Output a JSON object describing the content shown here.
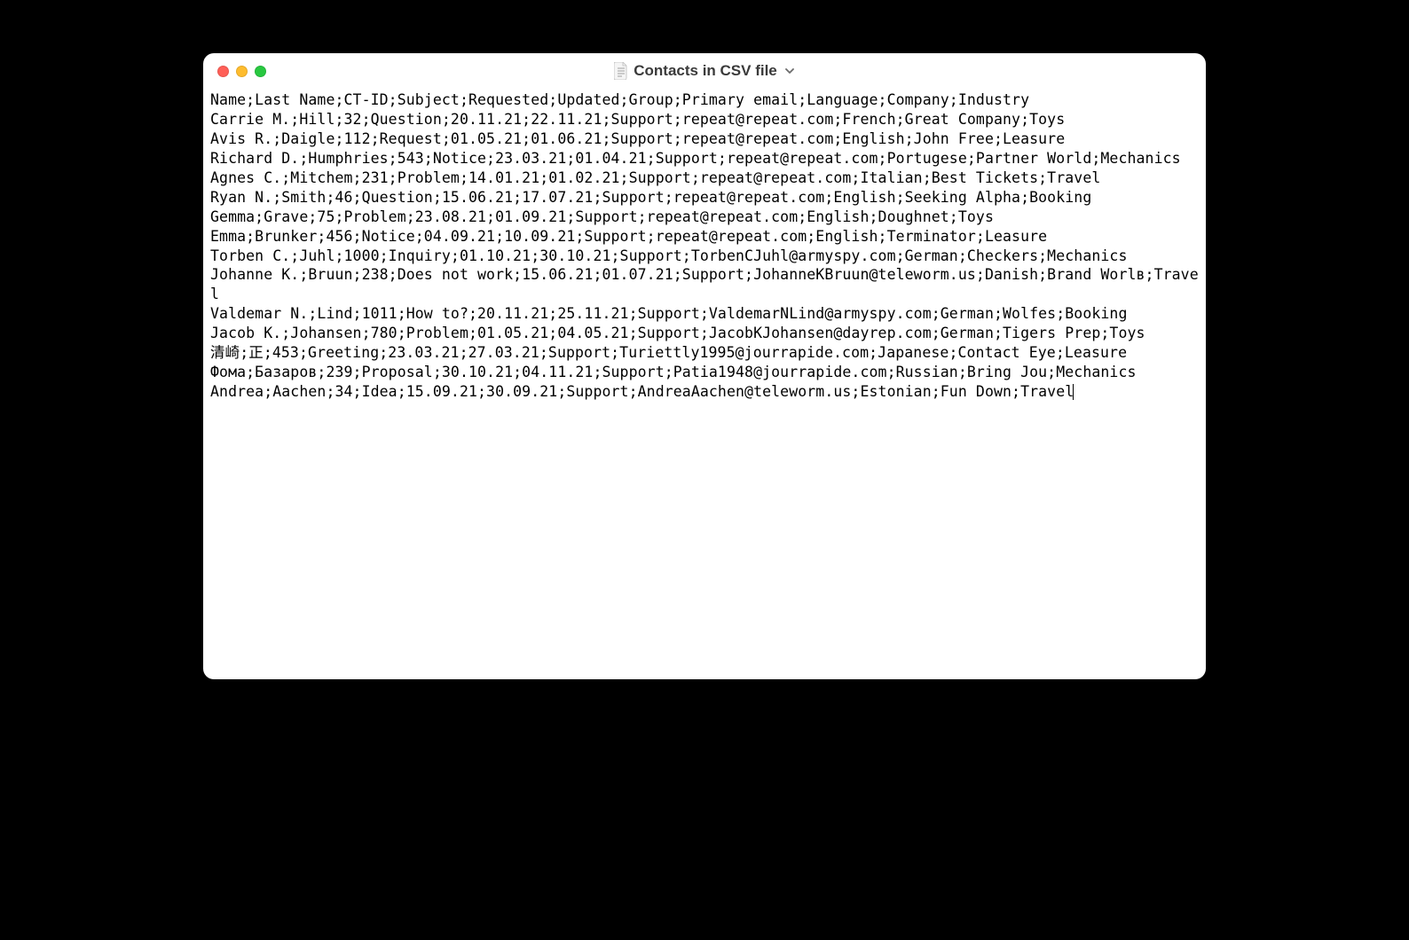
{
  "window": {
    "title": "Contacts in CSV file"
  },
  "csv": {
    "header": "Name;Last Name;CT-ID;Subject;Requested;Updated;Group;Primary email;Language;Company;Industry",
    "rows": [
      "Carrie M.;Hill;32;Question;20.11.21;22.11.21;Support;repeat@repeat.com;French;Great Company;Toys",
      "Avis R.;Daigle;112;Request;01.05.21;01.06.21;Support;repeat@repeat.com;English;John Free;Leasure",
      "Richard D.;Humphries;543;Notice;23.03.21;01.04.21;Support;repeat@repeat.com;Portugese;Partner World;Mechanics",
      "Agnes C.;Mitchem;231;Problem;14.01.21;01.02.21;Support;repeat@repeat.com;Italian;Best Tickets;Travel",
      "Ryan N.;Smith;46;Question;15.06.21;17.07.21;Support;repeat@repeat.com;English;Seeking Alpha;Booking",
      "Gemma;Grave;75;Problem;23.08.21;01.09.21;Support;repeat@repeat.com;English;Doughnet;Toys",
      "Emma;Brunker;456;Notice;04.09.21;10.09.21;Support;repeat@repeat.com;English;Terminator;Leasure",
      "Torben C.;Juhl;1000;Inquiry;01.10.21;30.10.21;Support;TorbenCJuhl@armyspy.com;German;Checkers;Mechanics",
      "Johanne K.;Bruun;238;Does not work;15.06.21;01.07.21;Support;JohanneKBruun@teleworm.us;Danish;Brand Worlв;Travel",
      "Valdemar N.;Lind;1011;How to?;20.11.21;25.11.21;Support;ValdemarNLind@armyspy.com;German;Wolfes;Booking",
      "Jacob K.;Johansen;780;Problem;01.05.21;04.05.21;Support;JacobKJohansen@dayrep.com;German;Tigers Prep;Toys",
      "清崎;正;453;Greeting;23.03.21;27.03.21;Support;Turiettly1995@jourrapide.com;Japanese;Contact Eye;Leasure",
      "Фома;Базаров;239;Proposal;30.10.21;04.11.21;Support;Patia1948@jourrapide.com;Russian;Bring Jou;Mechanics",
      "Andrea;Aachen;34;Idea;15.09.21;30.09.21;Support;AndreaAachen@teleworm.us;Estonian;Fun Down;Travel"
    ]
  }
}
